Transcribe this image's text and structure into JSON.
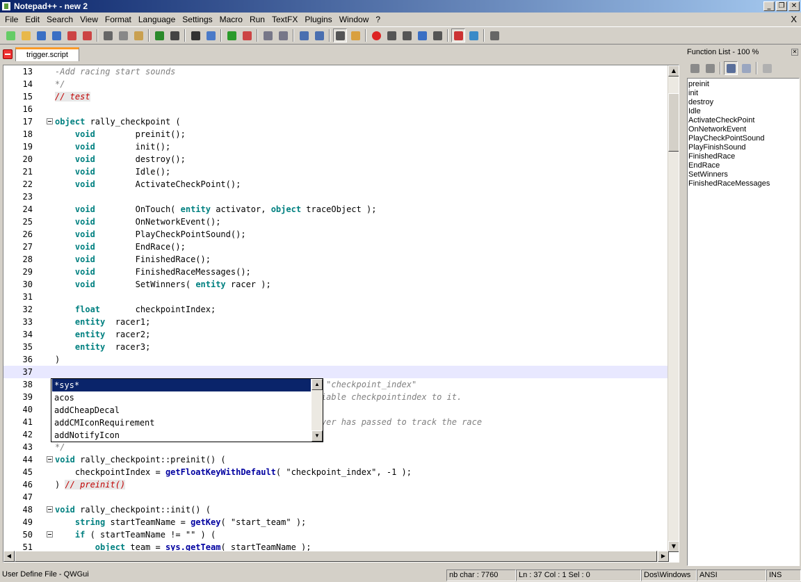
{
  "window": {
    "title": "Notepad++ - new 2",
    "buttons": [
      "_",
      "❐",
      "✕"
    ]
  },
  "menu": [
    "File",
    "Edit",
    "Search",
    "View",
    "Format",
    "Language",
    "Settings",
    "Macro",
    "Run",
    "TextFX",
    "Plugins",
    "Window",
    "?"
  ],
  "menu_close": "X",
  "tab": {
    "label": "trigger.script"
  },
  "function_list": {
    "title": "Function List - 100 %",
    "items": [
      "preinit",
      "init",
      "destroy",
      "Idle",
      "ActivateCheckPoint",
      "OnNetworkEvent",
      "PlayCheckPointSound",
      "PlayFinishSound",
      "FinishedRace",
      "EndRace",
      "SetWinners",
      "FinishedRaceMessages"
    ]
  },
  "editor": {
    "lines": [
      {
        "n": "13",
        "t": "-Add racing start sounds",
        "s": "c"
      },
      {
        "n": "14",
        "t": "*/",
        "s": "c"
      },
      {
        "n": "15",
        "t": "// test",
        "s": "r"
      },
      {
        "n": "16",
        "t": ""
      },
      {
        "n": "17",
        "t": "object rally_checkpoint (",
        "fold": true
      },
      {
        "n": "18",
        "t": "    void        preinit();"
      },
      {
        "n": "19",
        "t": "    void        init();"
      },
      {
        "n": "20",
        "t": "    void        destroy();"
      },
      {
        "n": "21",
        "t": "    void        Idle();"
      },
      {
        "n": "22",
        "t": "    void        ActivateCheckPoint();"
      },
      {
        "n": "23",
        "t": ""
      },
      {
        "n": "24",
        "t": "    void        OnTouch( entity activator, object traceObject );"
      },
      {
        "n": "25",
        "t": "    void        OnNetworkEvent();"
      },
      {
        "n": "26",
        "t": "    void        PlayCheckPointSound();"
      },
      {
        "n": "27",
        "t": "    void        EndRace();"
      },
      {
        "n": "28",
        "t": "    void        FinishedRace();"
      },
      {
        "n": "29",
        "t": "    void        FinishedRaceMessages();"
      },
      {
        "n": "30",
        "t": "    void        SetWinners( entity racer );"
      },
      {
        "n": "31",
        "t": ""
      },
      {
        "n": "32",
        "t": "    float       checkpointIndex;"
      },
      {
        "n": "33",
        "t": "    entity  racer1;"
      },
      {
        "n": "34",
        "t": "    entity  racer2;"
      },
      {
        "n": "35",
        "t": "    entity  racer3;"
      },
      {
        "n": "36",
        "t": ")"
      },
      {
        "n": "37",
        "t": "",
        "current": true
      },
      {
        "n": "38",
        "t": "                                          y with name \"checkpoint_index\"",
        "s": "c"
      },
      {
        "n": "39",
        "t": "                                          set the variable checkpointindex to it.",
        "s": "c"
      },
      {
        "n": "40",
        "t": "                                          s",
        "s": "c"
      },
      {
        "n": "41",
        "t": "                                          int the player has passed to track the race",
        "s": "c"
      },
      {
        "n": "42",
        "t": "",
        "s": "c"
      },
      {
        "n": "43",
        "t": "*/",
        "s": "c"
      },
      {
        "n": "44",
        "t": "void rally_checkpoint::preinit() (",
        "fold": true
      },
      {
        "n": "45",
        "t": "    checkpointIndex = getFloatKeyWithDefault( \"checkpoint_index\", -1 );"
      },
      {
        "n": "46",
        "t": ") // preinit()"
      },
      {
        "n": "47",
        "t": ""
      },
      {
        "n": "48",
        "t": "void rally_checkpoint::init() (",
        "fold": true
      },
      {
        "n": "49",
        "t": "    string startTeamName = getKey( \"start_team\" );"
      },
      {
        "n": "50",
        "t": "    if ( startTeamName != \"\" ) (",
        "fold": true
      },
      {
        "n": "51",
        "t": "        object team = sys.getTeam( startTeamName );"
      }
    ]
  },
  "autocomplete": {
    "items": [
      "*sys*",
      "acos",
      "addCheapDecal",
      "addCMIconRequirement",
      "addNotifyIcon"
    ],
    "selected_index": 0
  },
  "status": {
    "file_type": "User Define File - QWGui",
    "nb_char": "nb char : 7760",
    "position": "Ln : 37    Col : 1    Sel : 0",
    "eol": "Dos\\Windows",
    "encoding": "ANSI",
    "mode": "INS"
  },
  "toolbar_icons": [
    "new-file-icon",
    "open-file-icon",
    "save-icon",
    "save-all-icon",
    "close-icon",
    "close-all-icon",
    "sep",
    "cut-icon",
    "copy-icon",
    "paste-icon",
    "sep",
    "undo-icon",
    "redo-icon",
    "sep",
    "find-icon",
    "replace-icon",
    "sep",
    "zoom-in-icon",
    "zoom-out-icon",
    "sep",
    "sync-vertical-icon",
    "sync-horizontal-icon",
    "sep",
    "word-wrap-icon",
    "show-all-chars-icon",
    "sep",
    "indent-guide-icon",
    "user-lang-icon",
    "sep",
    "record-macro-icon",
    "stop-macro-icon",
    "play-macro-icon",
    "run-macro-multiple-icon",
    "save-macro-icon",
    "sep",
    "spell-check-icon",
    "spell-auto-icon",
    "sep",
    "print-icon"
  ]
}
